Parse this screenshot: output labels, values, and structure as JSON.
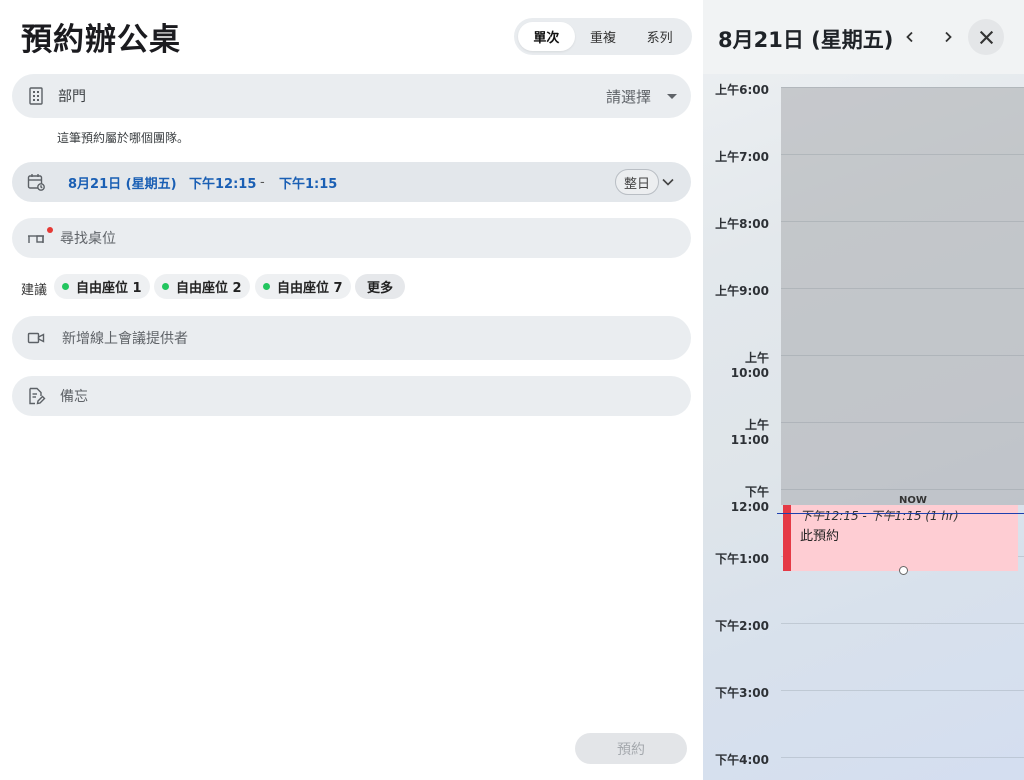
{
  "form": {
    "title": "預約辦公桌",
    "modes": [
      {
        "label": "單次",
        "active": true
      },
      {
        "label": "重複",
        "active": false
      },
      {
        "label": "系列",
        "active": false
      }
    ],
    "department": {
      "label": "部門",
      "placeholder": "請選擇",
      "hint": "這筆預約屬於哪個團隊。"
    },
    "datetime": {
      "date": "8月21日 (星期五)",
      "start": "下午12:15",
      "separator": "-",
      "end": "下午1:15",
      "all_day_label": "整日"
    },
    "desk_search": {
      "placeholder": "尋找桌位"
    },
    "suggestions": {
      "label": "建議",
      "items": [
        "自由座位 1",
        "自由座位 2",
        "自由座位 7"
      ],
      "more_label": "更多"
    },
    "online_meeting": {
      "placeholder": "新增線上會議提供者"
    },
    "notes": {
      "placeholder": "備忘"
    },
    "submit_label": "預約"
  },
  "calendar": {
    "day_title": "8月21日 (星期五)",
    "hours": [
      "上午6:00",
      "上午7:00",
      "上午8:00",
      "上午9:00",
      "上午10:00",
      "上午11:00",
      "下午12:00",
      "下午1:00",
      "下午2:00",
      "下午3:00",
      "下午4:00"
    ],
    "now_label": "NOW",
    "event": {
      "time": "下午12:15 - 下午1:15 (1 hr)",
      "title": "此預約"
    }
  },
  "colors": {
    "accent": "#1a5fb4",
    "event_fill": "#fecdd3",
    "event_bar": "#e53945",
    "available_dot": "#22c55e",
    "now_line": "#1e40af"
  }
}
